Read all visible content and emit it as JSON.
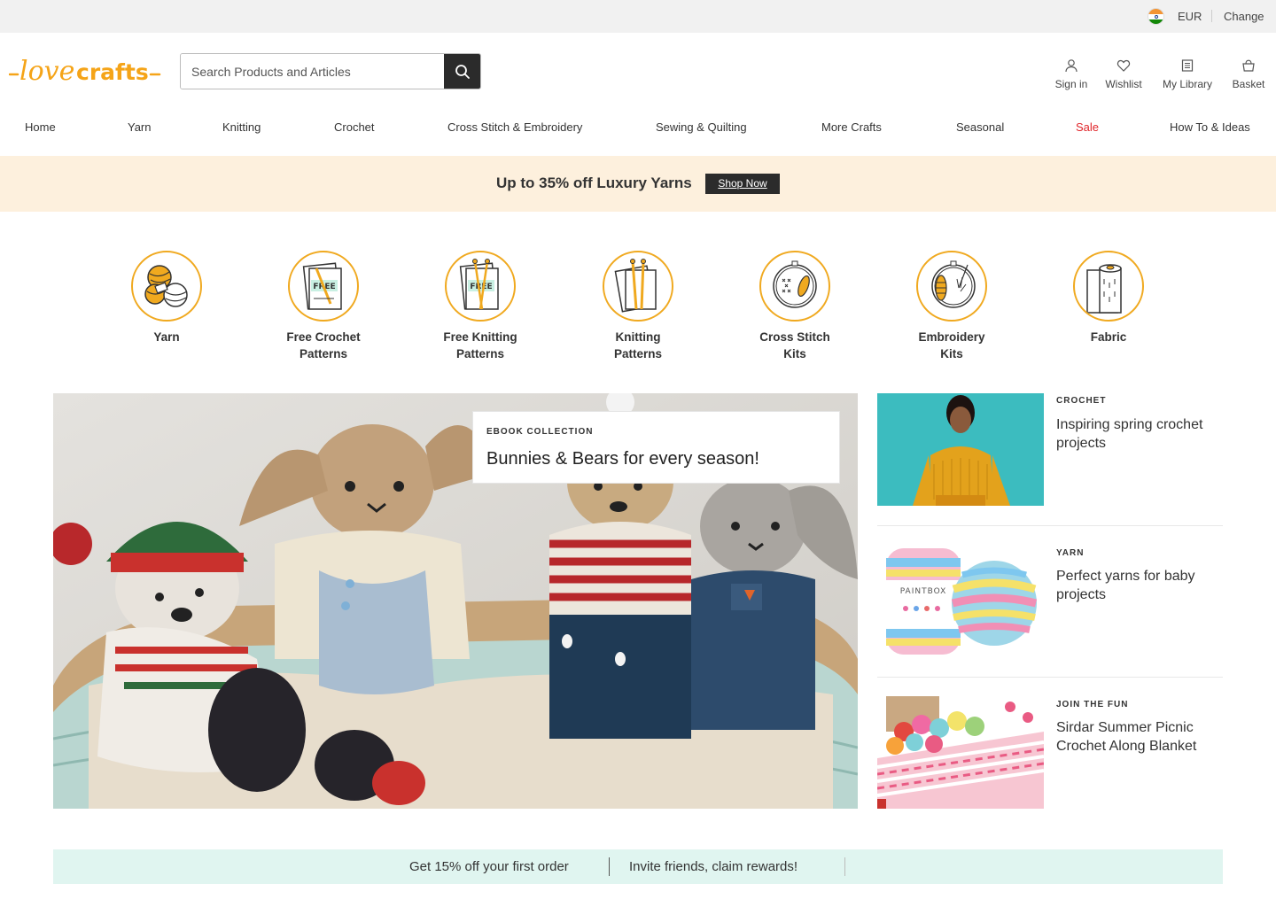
{
  "topbar": {
    "currency": "EUR",
    "change_label": "Change"
  },
  "brand": {
    "name": "lovecrafts",
    "color": "#f5a418"
  },
  "search": {
    "placeholder": "Search Products and Articles"
  },
  "header_icons": [
    {
      "label": "Sign in",
      "icon": "user-icon"
    },
    {
      "label": "Wishlist",
      "icon": "heart-icon"
    },
    {
      "label": "My Library",
      "icon": "library-icon"
    },
    {
      "label": "Basket",
      "icon": "basket-icon"
    }
  ],
  "nav": [
    "Home",
    "Yarn",
    "Knitting",
    "Crochet",
    "Cross Stitch & Embroidery",
    "Sewing & Quilting",
    "More Crafts",
    "Seasonal",
    "Sale",
    "How To & Ideas"
  ],
  "promo": {
    "text": "Up to 35% off Luxury Yarns",
    "button": "Shop Now"
  },
  "categories": [
    {
      "label1": "Yarn",
      "label2": ""
    },
    {
      "label1": "Free Crochet",
      "label2": "Patterns",
      "badge": "FREE"
    },
    {
      "label1": "Free Knitting",
      "label2": "Patterns",
      "badge": "FREE"
    },
    {
      "label1": "Knitting",
      "label2": "Patterns"
    },
    {
      "label1": "Cross Stitch",
      "label2": "Kits"
    },
    {
      "label1": "Embroidery",
      "label2": "Kits"
    },
    {
      "label1": "Fabric",
      "label2": ""
    }
  ],
  "hero": {
    "kicker": "EBOOK COLLECTION",
    "title": "Bunnies & Bears for every season!"
  },
  "articles": [
    {
      "kicker": "CROCHET",
      "title": "Inspiring spring crochet projects"
    },
    {
      "kicker": "YARN",
      "title": "Perfect yarns for baby projects",
      "brand_text": "PAINTBOX"
    },
    {
      "kicker": "JOIN THE FUN",
      "title": "Sirdar Summer Picnic Crochet Along Blanket"
    }
  ],
  "strip": {
    "left": "Get 15% off your first order",
    "right": "Invite friends, claim rewards!"
  }
}
